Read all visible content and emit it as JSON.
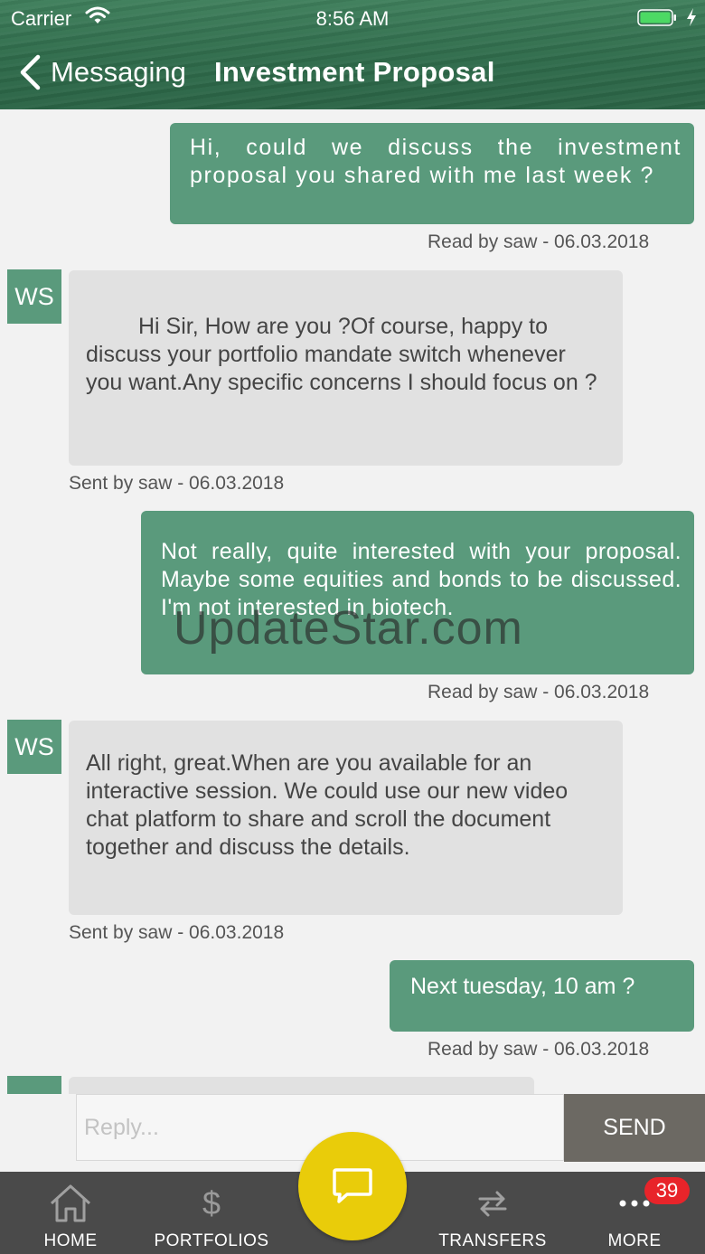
{
  "status_bar": {
    "carrier": "Carrier",
    "time": "8:56 AM",
    "icons": [
      "wifi-icon",
      "battery-icon",
      "charging-icon"
    ]
  },
  "header": {
    "back_label": "Messaging",
    "title": "Investment Proposal"
  },
  "messages": [
    {
      "direction": "out",
      "text": "Hi, could we discuss the investment proposal you shared with me last week ?",
      "meta": "Read by saw - 06.03.2018"
    },
    {
      "direction": "in",
      "avatar": "WS",
      "text": "Hi Sir, How are you ?Of course, happy to discuss your portfolio mandate switch whenever you want.Any specific concerns I should focus on ?",
      "meta": "Sent by saw - 06.03.2018"
    },
    {
      "direction": "out",
      "text": "Not really, quite interested with your proposal. Maybe some equities and bonds to be discussed. I'm not interested in biotech.",
      "meta": "Read by saw - 06.03.2018"
    },
    {
      "direction": "in",
      "avatar": "WS",
      "text": "All right, great.When are you available for an interactive session. We could use our new video chat platform to share and scroll the document together and discuss the details.",
      "meta": "Sent by saw - 06.03.2018"
    },
    {
      "direction": "out",
      "text": "Next tuesday, 10 am ?",
      "meta": "Read by saw - 06.03.2018"
    }
  ],
  "watermark": "UpdateStar.com",
  "reply": {
    "placeholder": "Reply...",
    "value": "",
    "send_label": "SEND"
  },
  "tab_bar": {
    "items": [
      {
        "label": "HOME",
        "icon": "home-icon"
      },
      {
        "label": "PORTFOLIOS",
        "icon": "dollar-icon"
      },
      {
        "label": "TRANSFERS",
        "icon": "transfer-arrows-icon"
      },
      {
        "label": "MORE",
        "icon": "more-dots-icon"
      }
    ],
    "more_badge": "39",
    "fab_icon": "chat-bubble-icon"
  },
  "colors": {
    "header": "#2f6b4b",
    "outgoing_bubble": "#5a9a7c",
    "incoming_bubble": "#e1e1e1",
    "send_button": "#6c6963",
    "tab_bar": "#4a4a4a",
    "fab": "#e9cc0a",
    "badge": "#e8242a"
  }
}
